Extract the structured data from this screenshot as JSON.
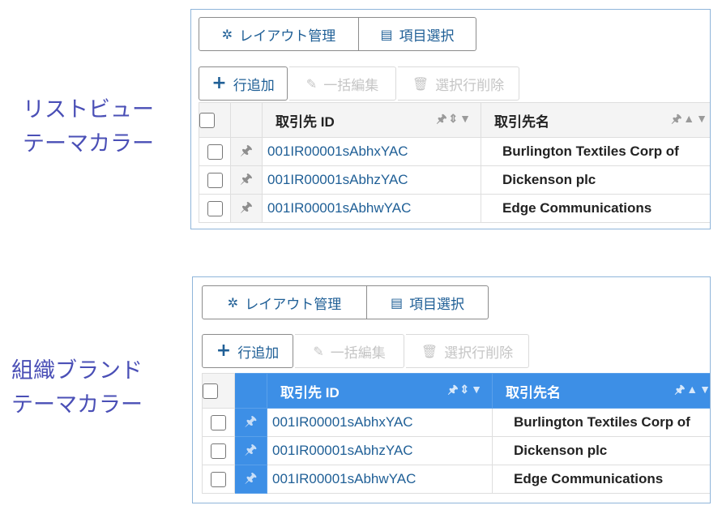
{
  "labels": {
    "list_view": [
      "リストビュー",
      "テーマカラー"
    ],
    "brand": [
      "組織ブランド",
      "テーマカラー"
    ]
  },
  "toolbar": {
    "layout": "レイアウト管理",
    "columns": "項目選択",
    "add_row": "行追加",
    "bulk_edit": "一括編集",
    "delete_selected": "選択行削除"
  },
  "columns": {
    "id": "取引先 ID",
    "name": "取引先名"
  },
  "rows": [
    {
      "id": "001IR00001sAbhxYAC",
      "name": "Burlington Textiles Corp of"
    },
    {
      "id": "001IR00001sAbhzYAC",
      "name": "Dickenson plc"
    },
    {
      "id": "001IR00001sAbhwYAC",
      "name": "Edge Communications"
    }
  ],
  "colors": {
    "brand_header": "#3d8fe6",
    "label_text": "#4a4fb6",
    "link": "#1f5f96"
  },
  "icons": [
    "gear-icon",
    "columns-icon",
    "plus-icon",
    "edit-icon",
    "trash-icon",
    "pin-icon",
    "sort-icon",
    "filter-icon"
  ]
}
